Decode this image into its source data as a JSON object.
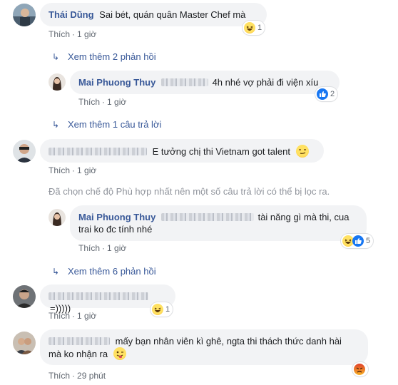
{
  "comments": [
    {
      "author": "Thái Dũng",
      "text": "Sai bét, quán quân Master Chef mà",
      "like": "Thích",
      "time": "1 giờ",
      "reaction_count": "1",
      "more": "Xem thêm 2 phản hồi"
    },
    {
      "author": "Mai Phuong Thuy",
      "text": "4h nhé vợ phải đi viện xíu",
      "like": "Thích",
      "time": "1 giờ",
      "reaction_count": "2",
      "more": "Xem thêm 1 câu trả lời"
    },
    {
      "text": "E tưởng chị thi Vietnam got talent",
      "like": "Thích",
      "time": "1 giờ"
    },
    {
      "author": "Mai Phuong Thuy",
      "text_line1": "tài năng gì mà thi, cua",
      "text_line2": "trai ko đc tính nhé",
      "like": "Thích",
      "time": "1 giờ",
      "reaction_count": "5",
      "more": "Xem thêm 6 phản hồi"
    },
    {
      "text": "=)))))",
      "like": "Thích",
      "time": "1 giờ",
      "reaction_count": "1"
    },
    {
      "text_line1": "mấy bạn nhân viên kì ghê, ngta thi thách thức danh hài",
      "text_line2": "mà ko nhận ra",
      "like": "Thích",
      "time": "29 phút"
    }
  ],
  "filter_note": "Đã chọn chế độ Phù hợp nhất nên một số câu trả lời có thể bị lọc ra.",
  "colors": {
    "link": "#385898",
    "bubble": "#f2f3f5",
    "meta": "#606770"
  },
  "icons": [
    "reply-arrow-icon",
    "haha-reaction-icon",
    "like-reaction-icon",
    "angry-reaction-icon",
    "smirk-emoji-icon",
    "wink-tongue-emoji-icon"
  ]
}
